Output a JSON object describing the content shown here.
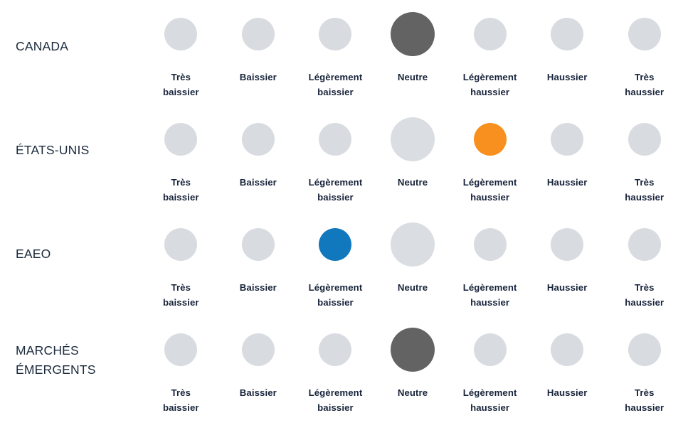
{
  "columns": [
    {
      "id": "tres-baissier",
      "label": "Très\nbaissier"
    },
    {
      "id": "baissier",
      "label": "Baissier"
    },
    {
      "id": "legerement-baissier",
      "label": "Légèrement\nbaissier"
    },
    {
      "id": "neutre",
      "label": "Neutre"
    },
    {
      "id": "legerement-haussier",
      "label": "Légèrement\nhaussier"
    },
    {
      "id": "haussier",
      "label": "Haussier"
    },
    {
      "id": "tres-haussier",
      "label": "Très\nhaussier"
    }
  ],
  "rows": [
    {
      "id": "canada",
      "label": "CANADA",
      "cells": [
        {
          "state": "idle",
          "size": "sm"
        },
        {
          "state": "idle",
          "size": "sm"
        },
        {
          "state": "idle",
          "size": "sm"
        },
        {
          "state": "neutral",
          "size": "lg"
        },
        {
          "state": "idle",
          "size": "sm"
        },
        {
          "state": "idle",
          "size": "sm"
        },
        {
          "state": "idle",
          "size": "sm"
        }
      ]
    },
    {
      "id": "etats-unis",
      "label": "ÉTATS-UNIS",
      "cells": [
        {
          "state": "idle",
          "size": "sm"
        },
        {
          "state": "idle",
          "size": "sm"
        },
        {
          "state": "idle",
          "size": "sm"
        },
        {
          "state": "previous",
          "size": "lg"
        },
        {
          "state": "up",
          "size": "sm"
        },
        {
          "state": "idle",
          "size": "sm"
        },
        {
          "state": "idle",
          "size": "sm"
        }
      ]
    },
    {
      "id": "eaeo",
      "label": "EAEO",
      "cells": [
        {
          "state": "idle",
          "size": "sm"
        },
        {
          "state": "idle",
          "size": "sm"
        },
        {
          "state": "down",
          "size": "sm"
        },
        {
          "state": "previous",
          "size": "lg"
        },
        {
          "state": "idle",
          "size": "sm"
        },
        {
          "state": "idle",
          "size": "sm"
        },
        {
          "state": "idle",
          "size": "sm"
        }
      ]
    },
    {
      "id": "marches-emergents",
      "label": "MARCHÉS\nÉMERGENTS",
      "cells": [
        {
          "state": "idle",
          "size": "sm"
        },
        {
          "state": "idle",
          "size": "sm"
        },
        {
          "state": "idle",
          "size": "sm"
        },
        {
          "state": "neutral",
          "size": "lg"
        },
        {
          "state": "idle",
          "size": "sm"
        },
        {
          "state": "idle",
          "size": "sm"
        },
        {
          "state": "idle",
          "size": "sm"
        }
      ]
    }
  ],
  "colors": {
    "idle": "#D8DBE0",
    "previous": "#DADDE2",
    "neutral": "#636363",
    "bullish": "#F7901E",
    "bearish": "#1278BE",
    "row_label_text": "#1B2A3C",
    "cell_label_text": "#17233A",
    "background": "#FFFFFF"
  }
}
